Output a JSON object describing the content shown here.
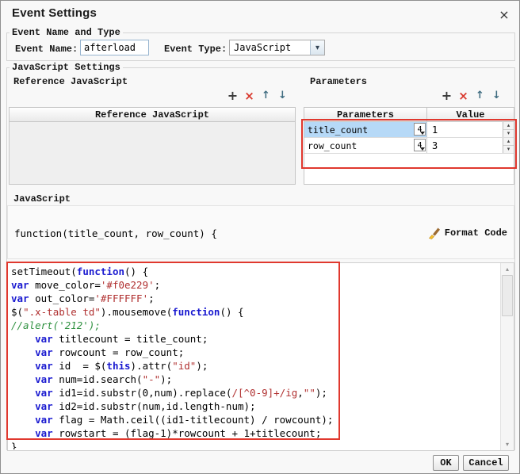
{
  "window": {
    "title": "Event Settings",
    "close_icon": "×"
  },
  "icons": {
    "chevron_down": "▾",
    "add": "+",
    "delete": "×",
    "move_up": "↑",
    "move_down": "↓",
    "scroll_up": "▴",
    "scroll_down": "▾"
  },
  "event_section": {
    "group_label": "Event Name and Type",
    "event_name_label": "Event Name:",
    "event_name_value": "afterload",
    "event_type_label": "Event Type:",
    "event_type_value": "JavaScript"
  },
  "js_settings": {
    "group_label": "JavaScript Settings",
    "reference_label": "Reference JavaScript",
    "parameters_label": "Parameters",
    "reference_table": {
      "header": "Reference JavaScript",
      "rows": []
    },
    "parameters_table": {
      "name_header": "Parameters",
      "value_header": "Value",
      "spinner_up_icon": "▴",
      "spinner_down_icon": "▾",
      "rows": [
        {
          "name": "title_count",
          "type_badge": "4",
          "value": "1",
          "selected": true
        },
        {
          "name": "row_count",
          "type_badge": "4",
          "value": "3",
          "selected": false
        }
      ]
    }
  },
  "javascript_section": {
    "label": "JavaScript",
    "function_signature": "function(title_count, row_count) {",
    "format_code_label": "Format Code"
  },
  "code": {
    "lines": [
      [
        [
          "setTimeout(",
          "p"
        ],
        [
          "function",
          "k"
        ],
        [
          "() {",
          "p"
        ]
      ],
      [
        [
          "var",
          "k"
        ],
        [
          " move_color=",
          "p"
        ],
        [
          "'#f0e229'",
          "s"
        ],
        [
          ";",
          "p"
        ]
      ],
      [
        [
          "var",
          "k"
        ],
        [
          " out_color=",
          "p"
        ],
        [
          "'#FFFFFF'",
          "s"
        ],
        [
          ";",
          "p"
        ]
      ],
      [
        [
          "$(",
          "p"
        ],
        [
          "\".x-table td\"",
          "s"
        ],
        [
          ").mousemove(",
          "p"
        ],
        [
          "function",
          "k"
        ],
        [
          "() {",
          "p"
        ]
      ],
      [
        [
          "//alert('212');",
          "c"
        ]
      ],
      [
        [
          "    ",
          "p"
        ],
        [
          "var",
          "k"
        ],
        [
          " titlecount = title_count;",
          "p"
        ]
      ],
      [
        [
          "    ",
          "p"
        ],
        [
          "var",
          "k"
        ],
        [
          " rowcount = row_count;",
          "p"
        ]
      ],
      [
        [
          "    ",
          "p"
        ],
        [
          "var",
          "k"
        ],
        [
          " id  = $(",
          "p"
        ],
        [
          "this",
          "k"
        ],
        [
          ").attr(",
          "p"
        ],
        [
          "\"id\"",
          "s"
        ],
        [
          ");",
          "p"
        ]
      ],
      [
        [
          "    ",
          "p"
        ],
        [
          "var",
          "k"
        ],
        [
          " num=id.search(",
          "p"
        ],
        [
          "\"-\"",
          "s"
        ],
        [
          ");",
          "p"
        ]
      ],
      [
        [
          "    ",
          "p"
        ],
        [
          "var",
          "k"
        ],
        [
          " id1=id.substr(0,num).replace(",
          "p"
        ],
        [
          "/[^0-9]+/ig",
          "s"
        ],
        [
          ",",
          "p"
        ],
        [
          "\"\"",
          "s"
        ],
        [
          ");",
          "p"
        ]
      ],
      [
        [
          "    ",
          "p"
        ],
        [
          "var",
          "k"
        ],
        [
          " id2=id.substr(num,id.length-num);",
          "p"
        ]
      ],
      [
        [
          "    ",
          "p"
        ],
        [
          "var",
          "k"
        ],
        [
          " flag = Math.ceil((id1-titlecount) / rowcount);",
          "p"
        ]
      ],
      [
        [
          "    ",
          "p"
        ],
        [
          "var",
          "k"
        ],
        [
          " rowstart = (flag-1)*rowcount + 1+titlecount;",
          "p"
        ]
      ],
      [
        [
          "}",
          "p"
        ]
      ]
    ]
  },
  "buttons": {
    "ok": "OK",
    "cancel": "Cancel"
  },
  "colors": {
    "annotation": "#e0382e",
    "keyword": "#1a1ad0",
    "string": "#b03030",
    "comment": "#2f9140",
    "selected_row": "#b6d9f7",
    "delete_icon": "#d93a2f"
  }
}
